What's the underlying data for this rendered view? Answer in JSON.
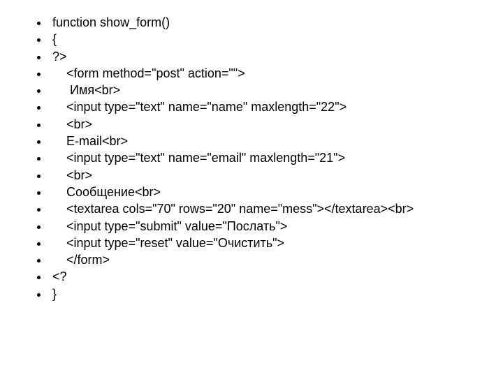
{
  "code": {
    "lines": [
      " function show_form()",
      " {",
      " ?>",
      "     <form method=\"post\" action=\"\">",
      "      Имя<br>",
      "     <input type=\"text\" name=\"name\" maxlength=\"22\">",
      "     <br>",
      "     E-mail<br>",
      "     <input type=\"text\" name=\"email\" maxlength=\"21\">",
      "     <br>",
      "     Сообщение<br>",
      "     <textarea cols=\"70\" rows=\"20\" name=\"mess\"></textarea><br>",
      "     <input type=\"submit\" value=\"Послать\">",
      "     <input type=\"reset\" value=\"Очистить\">",
      "     </form>",
      " <?",
      " }"
    ]
  }
}
